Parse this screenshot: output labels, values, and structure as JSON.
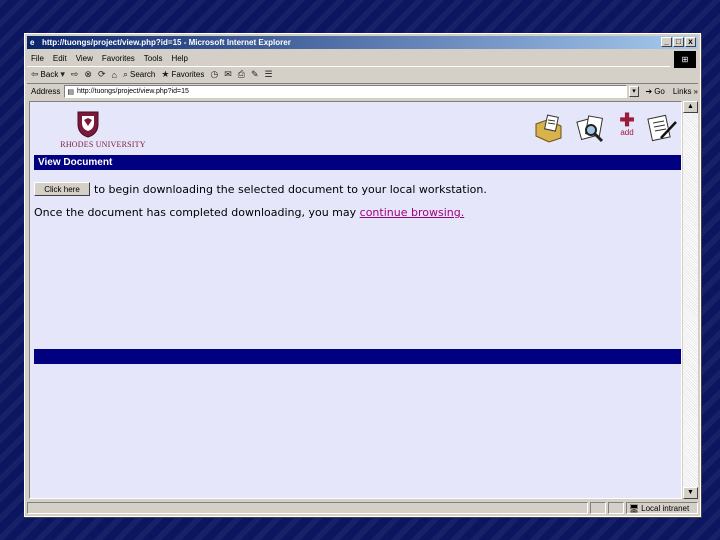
{
  "window": {
    "title": "http://tuongs/project/view.php?id=15 - Microsoft Internet Explorer",
    "controls": [
      "_",
      "□",
      "x"
    ]
  },
  "menu": [
    "File",
    "Edit",
    "View",
    "Favorites",
    "Tools",
    "Help"
  ],
  "toolbar": {
    "back": "Back",
    "search": "Search",
    "favorites": "Favorites"
  },
  "address": {
    "label": "Address",
    "value": "http://tuongs/project/view.php?id=15",
    "go": "Go",
    "links": "Links"
  },
  "page": {
    "university": "RHODES UNIVERSITY",
    "add_label": "add",
    "section_title": "View Document",
    "click_button": "Click here",
    "line1_text": "to begin downloading the selected document to your local workstation.",
    "line2_text": "Once the document has completed downloading, you may ",
    "line2_link": "continue browsing."
  },
  "status": {
    "zone": "Local intranet"
  }
}
